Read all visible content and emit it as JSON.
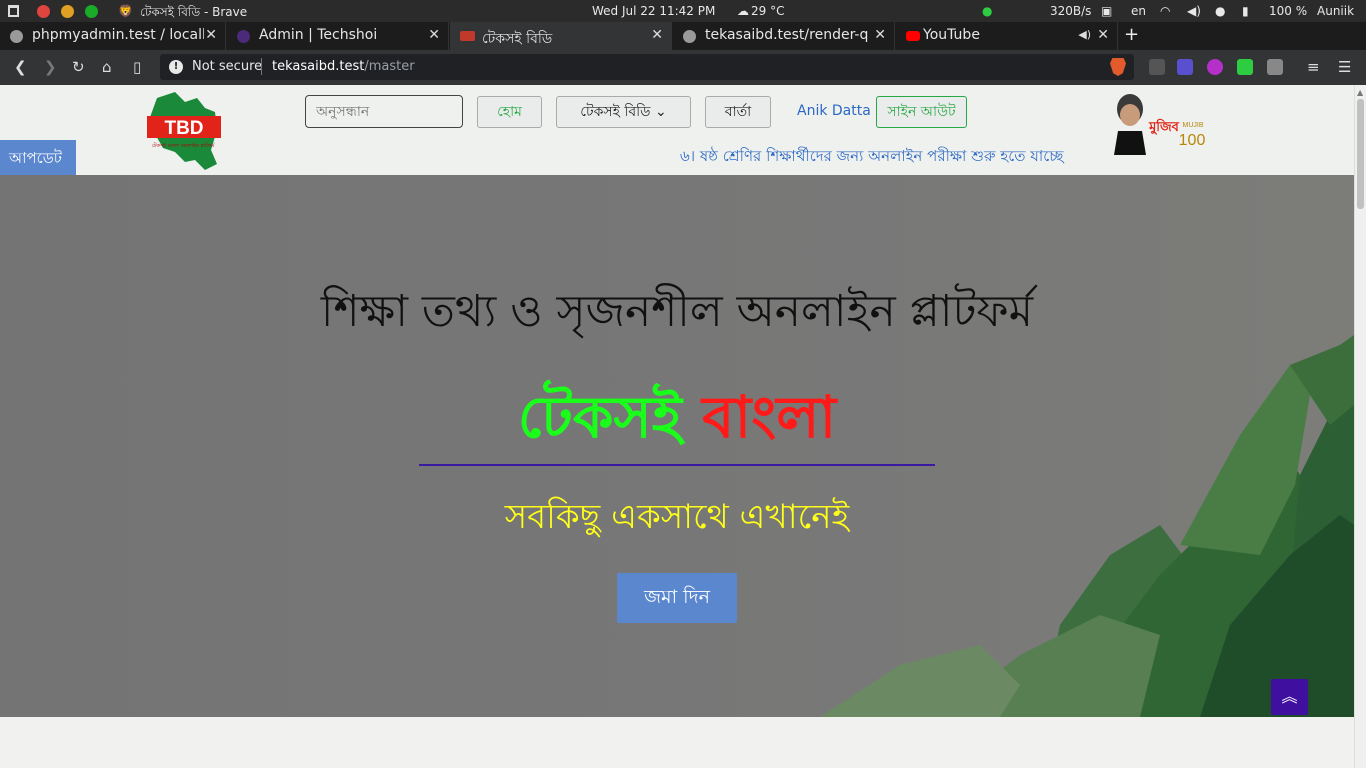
{
  "os": {
    "window_title": "টেকসই বিডি - Brave",
    "datetime": "Wed Jul 22  11:42 PM",
    "weather": "29 °C",
    "net_speed": "320B/s",
    "lang": "en",
    "battery": "100 %",
    "user": "Auniik"
  },
  "tabs": [
    {
      "title": "phpmyadmin.test / localho",
      "fav_color": "#9aa0a6"
    },
    {
      "title": "Admin | Techshoi",
      "fav_color": "#4b2a7a"
    },
    {
      "title": "টেকসই বিডি",
      "fav_color": "#c0392b"
    },
    {
      "title": "tekasaibd.test/render-que",
      "fav_color": "#9aa0a6"
    },
    {
      "title": "YouTube",
      "fav_color": "#ff0000"
    }
  ],
  "addressbar": {
    "security": "Not secure",
    "url_host": "tekasaibd.test",
    "url_path": "/master"
  },
  "header": {
    "logo_text": "TBD",
    "logo_tagline": "টেকসই বাংলা অনলাইন প্লাটফর্ম",
    "search_placeholder": "অনুসন্ধান",
    "home": "হোম",
    "brand_menu": "টেকসই বিডি",
    "news": "বার্তা",
    "user_name": "Anik Datta",
    "signout": "সাইন আউট",
    "update_badge": "আপডেট",
    "ticker": "৬। ষষ্ঠ শ্রেণির শিক্ষার্থীদের জন্য অনলাইন পরীক্ষা শুরু হতে যাচ্ছে",
    "mujib_text": "মুজিব",
    "mujib_number": "100",
    "mujib_sub": "MUJIB"
  },
  "hero": {
    "title": "শিক্ষা তথ্য ও সৃজনশীল অনলাইন প্লাটফর্ম",
    "brand_green": "টেকসই",
    "brand_red": "বাংলা",
    "tagline": "সবকিছু একসাথে এখানেই",
    "cta": "জমা দিন"
  },
  "colors": {
    "accent_blue": "#5b87cf",
    "success_green": "#28a745",
    "brand_green": "#1aff1a",
    "brand_red": "#ff1a1a",
    "tagline_yellow": "#ffff1a",
    "scroll_top_purple": "#3f0fa0"
  }
}
